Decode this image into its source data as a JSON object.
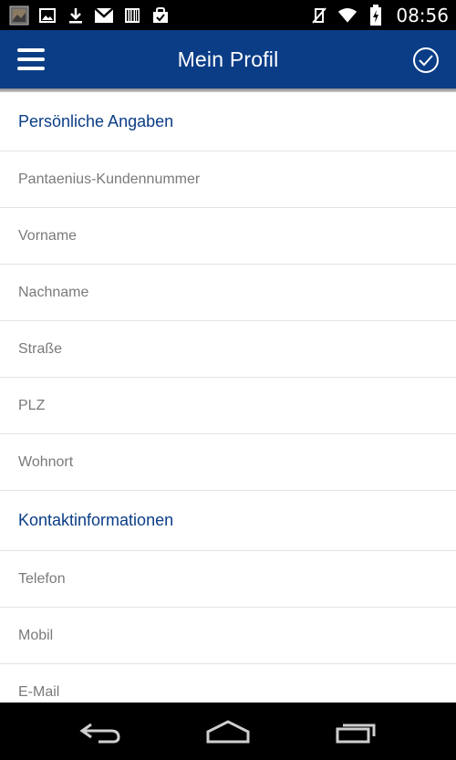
{
  "status_bar": {
    "time": "08:56",
    "icons_left": [
      "gallery-icon",
      "image-icon",
      "download-icon",
      "gmail-icon",
      "barcode-icon",
      "shopping-bag-icon"
    ],
    "icons_right": [
      "vibrate-off-icon",
      "wifi-icon",
      "battery-icon"
    ]
  },
  "app_bar": {
    "title": "Mein Profil",
    "left_icon": "menu-icon",
    "right_icon": "check-circle-icon",
    "color": "#0b3d86"
  },
  "sections": [
    {
      "header": "Persönliche Angaben",
      "fields": [
        "Pantaenius-Kundennummer",
        "Vorname",
        "Nachname",
        "Straße",
        "PLZ",
        "Wohnort"
      ]
    },
    {
      "header": "Kontaktinformationen",
      "fields": [
        "Telefon",
        "Mobil",
        "E-Mail"
      ]
    }
  ],
  "nav_bar": {
    "icons": [
      "back-icon",
      "home-icon",
      "recent-apps-icon"
    ]
  }
}
